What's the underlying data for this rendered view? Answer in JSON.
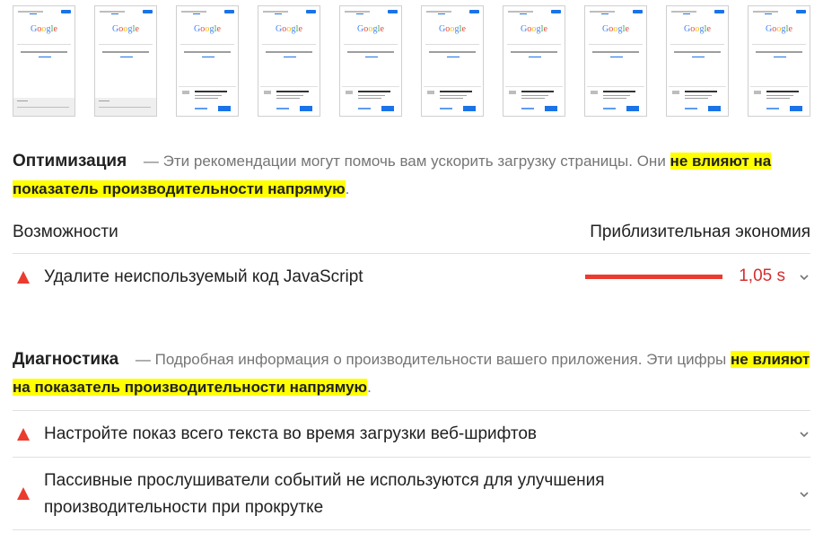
{
  "filmstrip": {
    "frames": [
      {
        "variant": "footer"
      },
      {
        "variant": "footer"
      },
      {
        "variant": "dialog"
      },
      {
        "variant": "dialog"
      },
      {
        "variant": "dialog"
      },
      {
        "variant": "dialog"
      },
      {
        "variant": "dialog"
      },
      {
        "variant": "dialog"
      },
      {
        "variant": "dialog"
      },
      {
        "variant": "dialog"
      }
    ],
    "logo_text": "Google",
    "logo_colors": [
      "#4285f4",
      "#ea4335",
      "#fbbc05",
      "#4285f4",
      "#34a853",
      "#ea4335"
    ]
  },
  "optimization": {
    "title": "Оптимизация",
    "dash": "—",
    "desc": "Эти рекомендации могут помочь вам ускорить загрузку страницы. Они",
    "highlight": "не влияют на показатель производительности напрямую",
    "end": "."
  },
  "opportunities": {
    "left": "Возможности",
    "right": "Приблизительная экономия",
    "items": [
      {
        "label": "Удалите неиспользуемый код JavaScript",
        "saving": "1,05 s",
        "saving_ratio": 1.0
      }
    ]
  },
  "diagnostics": {
    "title": "Диагностика",
    "dash": "—",
    "desc": "Подробная информация о производительности вашего приложения. Эти цифры",
    "highlight": "не влияют на показатель производительности напрямую",
    "end": ".",
    "items": [
      {
        "label": "Настройте показ всего текста во время загрузки веб-шрифтов"
      },
      {
        "label_line1": "Пассивные прослушиватели событий не используются для улучшения",
        "label_line2": "производительности при прокрутке"
      }
    ]
  },
  "colors": {
    "fail": "#eb3b2e",
    "highlight": "#ffff00",
    "link": "#1a73e8"
  },
  "icons": {
    "fail": "triangle-fail-icon",
    "expand": "chevron-down-icon"
  }
}
